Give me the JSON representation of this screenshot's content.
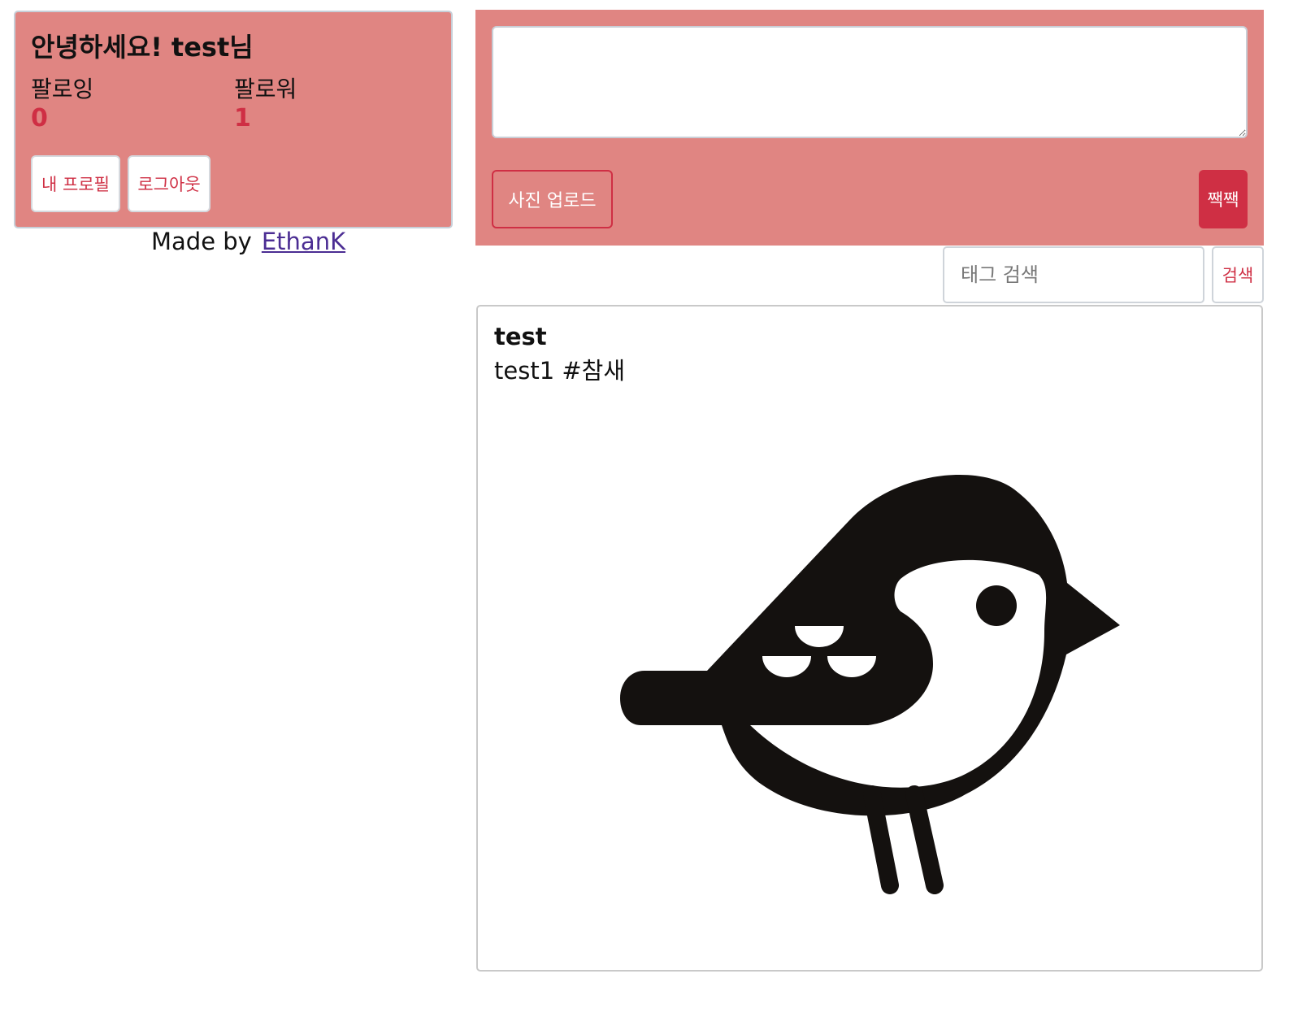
{
  "profile": {
    "greeting": "안녕하세요! test님",
    "following_label": "팔로잉",
    "following_count": "0",
    "follower_label": "팔로워",
    "follower_count": "1",
    "my_profile_button": "내 프로필",
    "logout_button": "로그아웃"
  },
  "footer": {
    "made_by": "Made by",
    "author_link": "EthanK"
  },
  "composer": {
    "textarea_value": "",
    "upload_button": "사진 업로드",
    "submit_button": "짹짹"
  },
  "search": {
    "placeholder": "태그 검색",
    "button": "검색"
  },
  "post": {
    "author": "test",
    "content": "test1 #참새",
    "image_icon": "sparrow-illustration"
  },
  "colors": {
    "panel_bg": "#e08582",
    "accent": "#cf2f44",
    "link": "#4b2d93"
  }
}
